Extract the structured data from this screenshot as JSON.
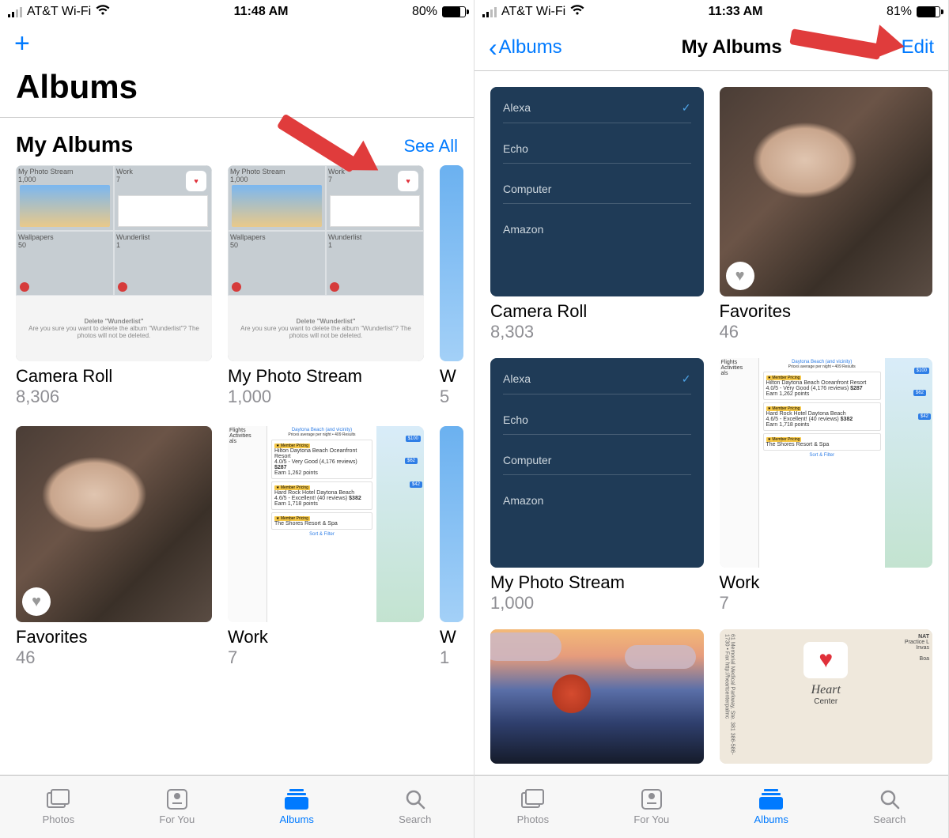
{
  "left": {
    "status": {
      "carrier": "AT&T Wi-Fi",
      "time": "11:48 AM",
      "battery_pct": "80%",
      "battery_fill": 80
    },
    "nav": {
      "add": "+"
    },
    "large_title": "Albums",
    "section": {
      "title": "My Albums",
      "see_all": "See All"
    },
    "albums_row1": [
      {
        "name": "Camera Roll",
        "count": "8,306",
        "thumb": "collage"
      },
      {
        "name": "My Photo Stream",
        "count": "1,000",
        "thumb": "collage"
      },
      {
        "name": "W",
        "count": "5",
        "thumb": "sky"
      }
    ],
    "albums_row2": [
      {
        "name": "Favorites",
        "count": "46",
        "thumb": "photo"
      },
      {
        "name": "Work",
        "count": "7",
        "thumb": "work"
      },
      {
        "name": "W",
        "count": "1",
        "thumb": "sky"
      }
    ],
    "collage": {
      "cell1_title": "My Photo Stream",
      "cell1_sub": "1,000",
      "cell2_title": "Work",
      "cell2_sub": "7",
      "cell3_title": "Wallpapers",
      "cell3_sub": "50",
      "cell4_title": "Wunderlist",
      "cell4_sub": "1",
      "dialog_title": "Delete \"Wunderlist\"",
      "dialog_body": "Are you sure you want to delete the album \"Wunderlist\"? The photos will not be deleted."
    },
    "tabs": {
      "photos": "Photos",
      "foryou": "For You",
      "albums": "Albums",
      "search": "Search"
    }
  },
  "right": {
    "status": {
      "carrier": "AT&T Wi-Fi",
      "time": "11:33 AM",
      "battery_pct": "81%",
      "battery_fill": 81
    },
    "nav": {
      "back": "Albums",
      "title": "My Albums",
      "edit": "Edit"
    },
    "albums": [
      {
        "name": "Camera Roll",
        "count": "8,303",
        "thumb": "alexa"
      },
      {
        "name": "Favorites",
        "count": "46",
        "thumb": "photo"
      },
      {
        "name": "My Photo Stream",
        "count": "1,000",
        "thumb": "alexa"
      },
      {
        "name": "Work",
        "count": "7",
        "thumb": "work"
      },
      {
        "name": "",
        "count": "",
        "thumb": "balloon"
      },
      {
        "name": "",
        "count": "",
        "thumb": "card"
      }
    ],
    "alexa_items": [
      "Alexa",
      "Echo",
      "Computer",
      "Amazon"
    ],
    "work_side": [
      "Flights",
      "Activities",
      "als"
    ],
    "work_header": "Daytona Beach (and vicinity)",
    "work_sub": "Prices average per night • 409 Results",
    "work_items": [
      {
        "title": "Hilton Daytona Beach Oceanfront Resort",
        "rating": "4.0/5 - Very Good (4,176 reviews)",
        "price": "$287",
        "pts": "Earn 1,262 points"
      },
      {
        "title": "Hard Rock Hotel Daytona Beach",
        "rating": "4.6/5 - Excellent! (40 reviews)",
        "price": "$382",
        "pts": "Earn 1,718 points"
      },
      {
        "title": "The Shores Resort & Spa",
        "rating": "",
        "price": "",
        "pts": ""
      }
    ],
    "work_footer": "Sort & Filter",
    "card": {
      "line1": "61 Memorial Medical Parkway, Ste. 381",
      "line2": "386-586-1730 • Fax",
      "line3": "http://heartcenterpalmc",
      "word": "Heart",
      "sub": "Center",
      "nat": "NAT",
      "role": "Practice L",
      "inv": "Invas",
      "bo": "Boa"
    },
    "tabs": {
      "photos": "Photos",
      "foryou": "For You",
      "albums": "Albums",
      "search": "Search"
    }
  }
}
